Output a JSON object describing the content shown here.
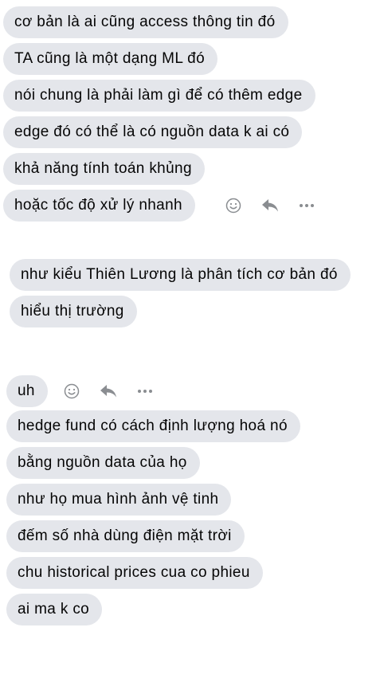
{
  "group1": {
    "messages": [
      "cơ bản là ai cũng access thông tin đó",
      "TA cũng là một dạng ML đó",
      "nói chung là phải làm gì để có thêm edge",
      "edge đó có thể là có nguồn data k ai có",
      "khả năng tính toán khủng",
      "hoặc tốc độ xử lý nhanh"
    ]
  },
  "group2": {
    "messages": [
      "như kiểu Thiên Lương là phân tích cơ bản đó",
      "hiểu thị trường"
    ]
  },
  "group3": {
    "messages": [
      "uh",
      "hedge fund có cách định lượng hoá nó",
      "bằng nguồn data của họ",
      "như họ mua hình ảnh vệ tinh",
      "đếm số nhà dùng điện mặt trời",
      "chu historical prices cua co phieu",
      "ai ma k co"
    ]
  },
  "icons": {
    "react": "smiley-icon",
    "reply": "reply-icon",
    "more": "more-icon"
  },
  "colors": {
    "bubble": "#e4e6eb",
    "text": "#050505",
    "icon": "#8a8d91"
  }
}
